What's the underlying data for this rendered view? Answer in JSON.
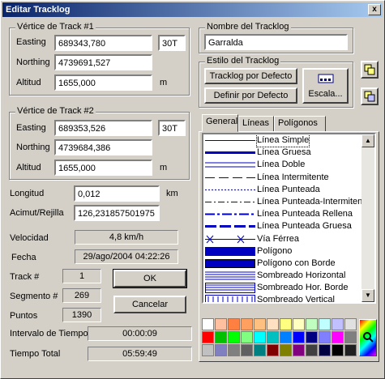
{
  "window": {
    "title": "Editar Tracklog",
    "close_glyph": "x"
  },
  "vertex1": {
    "label": "Vértice de Track #1",
    "easting_label": "Easting",
    "easting_value": "689343,780",
    "zone": "30T",
    "northing_label": "Northing",
    "northing_value": "4739691,527",
    "altitude_label": "Altitud",
    "altitude_value": "1655,000",
    "altitude_unit": "m"
  },
  "vertex2": {
    "label": "Vértice de Track #2",
    "easting_label": "Easting",
    "easting_value": "689353,526",
    "zone": "30T",
    "northing_label": "Northing",
    "northing_value": "4739684,386",
    "altitude_label": "Altitud",
    "altitude_value": "1655,000",
    "altitude_unit": "m"
  },
  "length": {
    "label": "Longitud",
    "value": "0,012",
    "unit": "km"
  },
  "azimuth": {
    "label": "Acimut/Rejilla",
    "value": "126,231857501975"
  },
  "speed": {
    "label": "Velocidad",
    "value": "4,8 km/h"
  },
  "date": {
    "label": "Fecha",
    "value": "29/ago/2004   04:22:26"
  },
  "track_num": {
    "label": "Track #",
    "value": "1"
  },
  "segment_num": {
    "label": "Segmento #",
    "value": "269"
  },
  "points": {
    "label": "Puntos",
    "value": "1390"
  },
  "time_interval": {
    "label": "Intervalo de Tiempo",
    "value": "00:00:09"
  },
  "total_time": {
    "label": "Tiempo Total",
    "value": "05:59:49"
  },
  "buttons": {
    "ok": "OK",
    "cancel": "Cancelar"
  },
  "track_name": {
    "label": "Nombre del Tracklog",
    "value": "Garralda"
  },
  "style": {
    "label": "Estilo del Tracklog",
    "default_button": "Tracklog por Defecto",
    "define_default_button": "Definir por Defecto",
    "scale_button": "Escala...",
    "scale_icon": "scale-icon"
  },
  "side_icons": [
    "copy-icon",
    "paste-icon"
  ],
  "tabs": [
    {
      "label": "General",
      "active": true
    },
    {
      "label": "Líneas",
      "active": false
    },
    {
      "label": "Polígonos",
      "active": false
    }
  ],
  "line_styles": [
    {
      "name": "Línea Simple",
      "selected": true,
      "kind": "simple"
    },
    {
      "name": "Línea  Gruesa",
      "selected": false,
      "kind": "thick"
    },
    {
      "name": "Línea Doble",
      "selected": false,
      "kind": "double"
    },
    {
      "name": "Línea Intermitente",
      "selected": false,
      "kind": "dash"
    },
    {
      "name": "Línea Punteada",
      "selected": false,
      "kind": "dot"
    },
    {
      "name": "Línea Punteada-Intermitente",
      "selected": false,
      "kind": "dashdot"
    },
    {
      "name": "Línea Punteada Rellena",
      "selected": false,
      "kind": "dotfill"
    },
    {
      "name": "Línea Punteada Gruesa",
      "selected": false,
      "kind": "dotthick"
    },
    {
      "name": "Vía Férrea",
      "selected": false,
      "kind": "rail"
    },
    {
      "name": "Polígono",
      "selected": false,
      "kind": "poly"
    },
    {
      "name": "Polígono con Borde",
      "selected": false,
      "kind": "polyborder"
    },
    {
      "name": "Sombreado Horizontal",
      "selected": false,
      "kind": "hatchh"
    },
    {
      "name": "Sombreado Hor. Borde",
      "selected": false,
      "kind": "hatchhb"
    },
    {
      "name": "Sombreado Vertical",
      "selected": false,
      "kind": "hatchv"
    }
  ],
  "palette_colors": [
    "#ffffff",
    "#ffc0a0",
    "#ff8040",
    "#ffa060",
    "#ffc080",
    "#ffe0c0",
    "#ffff80",
    "#ffffc0",
    "#c0ffc0",
    "#c0ffff",
    "#c0c0ff",
    "#e0e0e0",
    "#ff0000",
    "#00c000",
    "#00ff00",
    "#80ff80",
    "#00ffff",
    "#00c0c0",
    "#0080ff",
    "#0000ff",
    "#000080",
    "#8080ff",
    "#ff00ff",
    "#808080",
    "#c0c0c0",
    "#8080c0",
    "#808080",
    "#606060",
    "#008080",
    "#800000",
    "#808000",
    "#800080",
    "#404040",
    "#000040",
    "#000000",
    "#202020"
  ],
  "custom_color_icon": "color-picker-icon"
}
